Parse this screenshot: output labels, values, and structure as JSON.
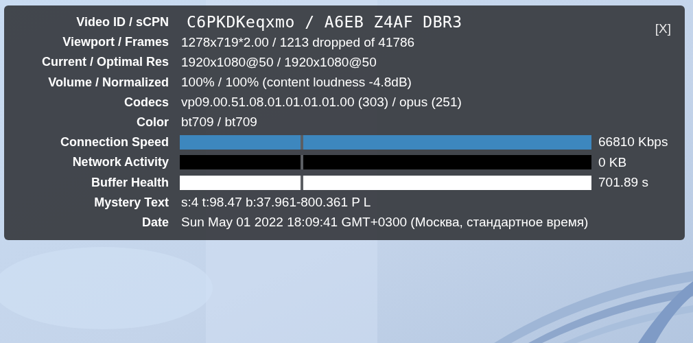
{
  "stats_panel": {
    "close_label": "[X]",
    "rows": [
      {
        "kind": "mono",
        "label": "Video ID / sCPN",
        "value": "C6PKDKeqxmo / A6EB Z4AF DBR3"
      },
      {
        "kind": "text",
        "label": "Viewport / Frames",
        "value": "1278x719*2.00 / 1213 dropped of 41786"
      },
      {
        "kind": "text",
        "label": "Current / Optimal Res",
        "value": "1920x1080@50 / 1920x1080@50"
      },
      {
        "kind": "text",
        "label": "Volume / Normalized",
        "value": "100% / 100% (content loudness -4.8dB)"
      },
      {
        "kind": "text",
        "label": "Codecs",
        "value": "vp09.00.51.08.01.01.01.01.00 (303) / opus (251)"
      },
      {
        "kind": "text",
        "label": "Color",
        "value": "bt709 / bt709"
      },
      {
        "kind": "graph",
        "label": "Connection Speed",
        "value": "66810 Kbps",
        "color": "#3d87be"
      },
      {
        "kind": "graph",
        "label": "Network Activity",
        "value": "0 KB",
        "color": "#000000"
      },
      {
        "kind": "graph",
        "label": "Buffer Health",
        "value": "701.89 s",
        "color": "#ffffff"
      },
      {
        "kind": "text",
        "label": "Mystery Text",
        "value": "s:4 t:98.47 b:37.961-800.361 P L"
      },
      {
        "kind": "text",
        "label": "Date",
        "value": "Sun May 01 2022 18:09:41 GMT+0300 (Москва, стандартное время)"
      }
    ]
  }
}
